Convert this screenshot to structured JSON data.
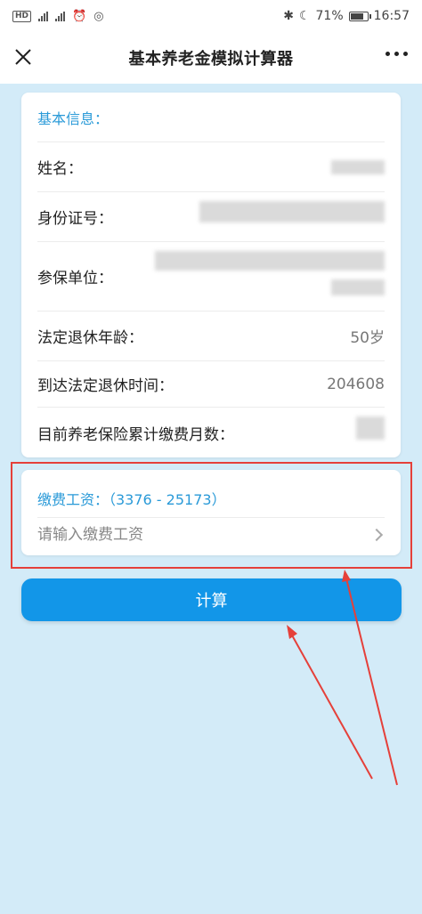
{
  "status_bar": {
    "left_badge": "HD",
    "signal1": "4G",
    "signal2": "4G",
    "battery": "71%",
    "time": "16:57"
  },
  "header": {
    "title": "基本养老金模拟计算器",
    "close_icon": "close-icon",
    "more_icon": "more-icon"
  },
  "basic_info": {
    "section_title": "基本信息：",
    "fields": [
      {
        "label": "姓名：",
        "value": ""
      },
      {
        "label": "身份证号：",
        "value": ""
      },
      {
        "label": "参保单位：",
        "value": ""
      },
      {
        "label": "法定退休年龄：",
        "value": "50岁"
      },
      {
        "label": "到达法定退休时间：",
        "value": "204608"
      },
      {
        "label": "目前养老保险累计缴费月数：",
        "value": ""
      }
    ]
  },
  "wage": {
    "title": "缴费工资：（3376 - 25173）",
    "placeholder": "请输入缴费工资",
    "value": ""
  },
  "calc_button": {
    "label": "计算"
  },
  "colors": {
    "accent": "#2a9ad8",
    "button": "#1296e8",
    "background": "#d3ebf8",
    "highlight": "#e5403a"
  }
}
